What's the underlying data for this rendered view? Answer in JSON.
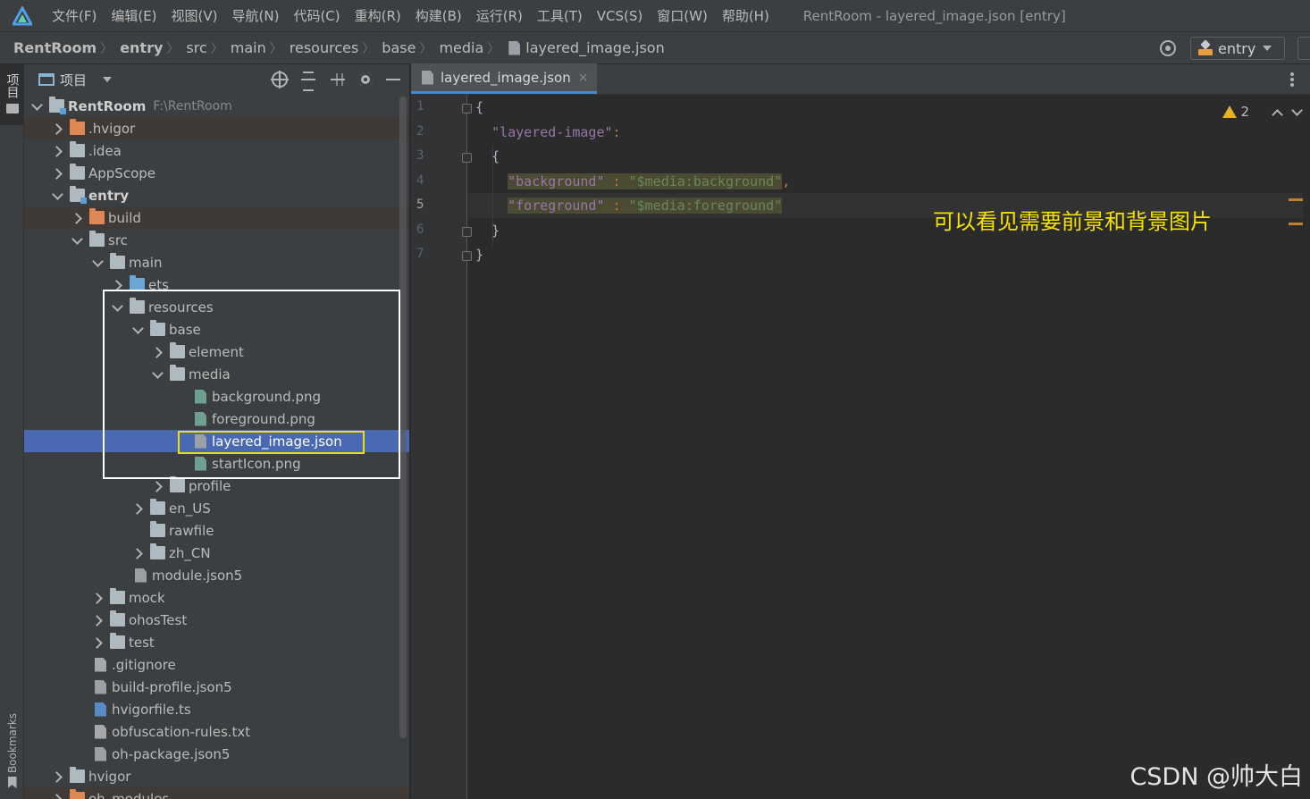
{
  "menubar": {
    "items": [
      "文件(F)",
      "编辑(E)",
      "视图(V)",
      "导航(N)",
      "代码(C)",
      "重构(R)",
      "构建(B)",
      "运行(R)",
      "工具(T)",
      "VCS(S)",
      "窗口(W)",
      "帮助(H)"
    ],
    "window_title": "RentRoom - layered_image.json [entry]"
  },
  "navbar": {
    "crumbs": [
      "RentRoom",
      "entry",
      "src",
      "main",
      "resources",
      "base",
      "media",
      "layered_image.json"
    ],
    "run_config": "entry"
  },
  "left_strip": {
    "project_label": "项目",
    "bookmarks_label": "Bookmarks"
  },
  "project_panel": {
    "title": "项目",
    "tree": [
      {
        "label": "RentRoom",
        "path": "F:\\RentRoom"
      },
      {
        "label": ".hvigor"
      },
      {
        "label": ".idea"
      },
      {
        "label": "AppScope"
      },
      {
        "label": "entry"
      },
      {
        "label": "build"
      },
      {
        "label": "src"
      },
      {
        "label": "main"
      },
      {
        "label": "ets"
      },
      {
        "label": "resources"
      },
      {
        "label": "base"
      },
      {
        "label": "element"
      },
      {
        "label": "media"
      },
      {
        "label": "background.png"
      },
      {
        "label": "foreground.png"
      },
      {
        "label": "layered_image.json"
      },
      {
        "label": "startIcon.png"
      },
      {
        "label": "profile"
      },
      {
        "label": "en_US"
      },
      {
        "label": "rawfile"
      },
      {
        "label": "zh_CN"
      },
      {
        "label": "module.json5"
      },
      {
        "label": "mock"
      },
      {
        "label": "ohosTest"
      },
      {
        "label": "test"
      },
      {
        "label": ".gitignore"
      },
      {
        "label": "build-profile.json5"
      },
      {
        "label": "hvigorfile.ts"
      },
      {
        "label": "obfuscation-rules.txt"
      },
      {
        "label": "oh-package.json5"
      },
      {
        "label": "hvigor"
      },
      {
        "label": "oh_modules"
      }
    ]
  },
  "editor": {
    "tab_label": "layered_image.json",
    "tab_close": "×",
    "line_numbers": [
      "1",
      "2",
      "3",
      "4",
      "5",
      "6",
      "7"
    ],
    "code": {
      "l1": "{",
      "l2_key": "\"layered-image\"",
      "l2_colon": ":",
      "l3": "{",
      "l4_key": "\"background\"",
      "l4_colon": " : ",
      "l4_val": "\"$media:background\"",
      "l4_comma": ",",
      "l5_key": "\"foreground\"",
      "l5_colon": " : ",
      "l5_val": "\"$media:foreground\"",
      "l6": "}",
      "l7": "}"
    },
    "warning_count": "2",
    "annotation": "可以看见需要前景和背景图片"
  },
  "watermark": "CSDN @帅大白",
  "colors": {
    "selection": "#4a69b3",
    "annotation_yellow": "#f5e100",
    "warning": "#e6b422"
  }
}
